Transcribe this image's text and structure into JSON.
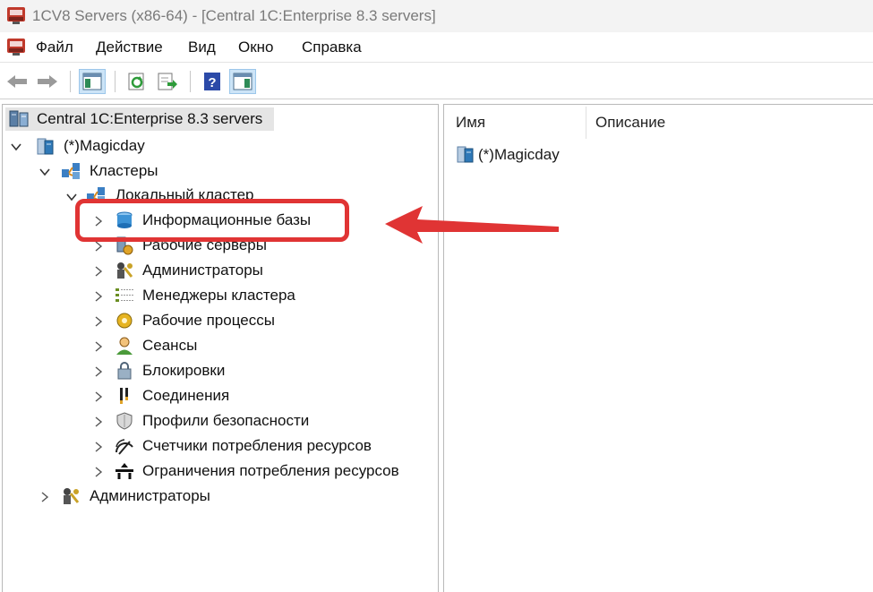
{
  "window": {
    "title": "1CV8 Servers (x86-64) - [Central 1C:Enterprise 8.3 servers]"
  },
  "menu": {
    "items": [
      "Файл",
      "Действие",
      "Вид",
      "Окно",
      "Справка"
    ]
  },
  "toolbar": {
    "buttons": [
      "back-icon",
      "forward-icon",
      "show-tree-icon",
      "refresh-icon",
      "export-icon",
      "help-icon",
      "show-action-pane-icon"
    ]
  },
  "tree": {
    "root": "Central 1C:Enterprise 8.3 servers",
    "server": "(*)Magicday",
    "clusters": "Кластеры",
    "local_cluster": "Локальный кластер",
    "items": [
      "Информационные базы",
      "Рабочие серверы",
      "Администраторы",
      "Менеджеры кластера",
      "Рабочие процессы",
      "Сеансы",
      "Блокировки",
      "Соединения",
      "Профили безопасности",
      "Счетчики потребления ресурсов",
      "Ограничения потребления ресурсов"
    ],
    "server_admins": "Администраторы"
  },
  "list": {
    "columns": [
      "Имя",
      "Описание"
    ],
    "rows": [
      {
        "name": "(*)Magicday",
        "description": ""
      }
    ]
  },
  "annotation": {
    "color": "#e03434"
  }
}
